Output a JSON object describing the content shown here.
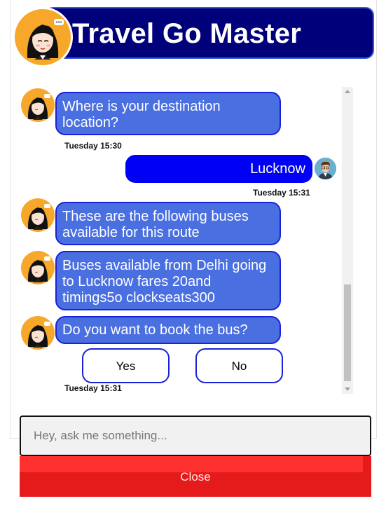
{
  "header": {
    "title": "Travel Go Master",
    "avatar_icon": "agent-avatar-icon"
  },
  "messages": [
    {
      "from": "bot",
      "text": "Where is your destination location?"
    },
    {
      "from": "user",
      "text": "Lucknow"
    },
    {
      "from": "bot",
      "text": "These are the following buses available for this route"
    },
    {
      "from": "bot",
      "text": "Buses available from Delhi going to Lucknow fares 20and timings5o clockseats300"
    },
    {
      "from": "bot",
      "text": "Do you want to book the bus?"
    }
  ],
  "timestamps": [
    "Tuesday 15:30",
    "Tuesday 15:31",
    "Tuesday 15:31"
  ],
  "choices": {
    "yes": "Yes",
    "no": "No"
  },
  "input": {
    "placeholder": "Hey, ask me something..."
  },
  "close_label": "Close",
  "colors": {
    "header_bg": "#00007a",
    "bot_bubble": "#4a6fe0",
    "user_bubble": "#0000f5",
    "close_button": "#e51b1b"
  }
}
